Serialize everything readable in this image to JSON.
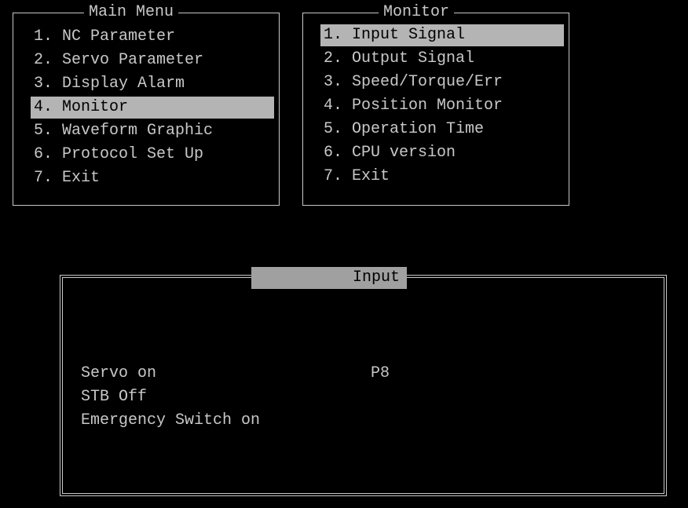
{
  "main_menu": {
    "title": "Main Menu",
    "items": [
      {
        "label": "1. NC Parameter"
      },
      {
        "label": "2. Servo Parameter"
      },
      {
        "label": "3. Display Alarm"
      },
      {
        "label": "4. Monitor",
        "selected": true
      },
      {
        "label": "5. Waveform Graphic"
      },
      {
        "label": "6. Protocol Set Up"
      },
      {
        "label": "7. Exit"
      }
    ]
  },
  "monitor_menu": {
    "title": "Monitor",
    "items": [
      {
        "label": "1. Input Signal",
        "selected": true
      },
      {
        "label": "2. Output Signal"
      },
      {
        "label": "3. Speed/Torque/Err"
      },
      {
        "label": "4. Position Monitor"
      },
      {
        "label": "5. Operation Time"
      },
      {
        "label": "6. CPU version"
      },
      {
        "label": "7. Exit"
      }
    ]
  },
  "input_panel": {
    "title": "Input",
    "signals": [
      {
        "name": "Servo on",
        "value": "P8"
      },
      {
        "name": "STB Off",
        "value": ""
      },
      {
        "name": "Emergency Switch on",
        "value": ""
      }
    ]
  },
  "colors": {
    "background": "#000000",
    "text": "#c8c8c8",
    "highlight": "#b4b4b4",
    "title_bar": "#a0a0a0"
  }
}
